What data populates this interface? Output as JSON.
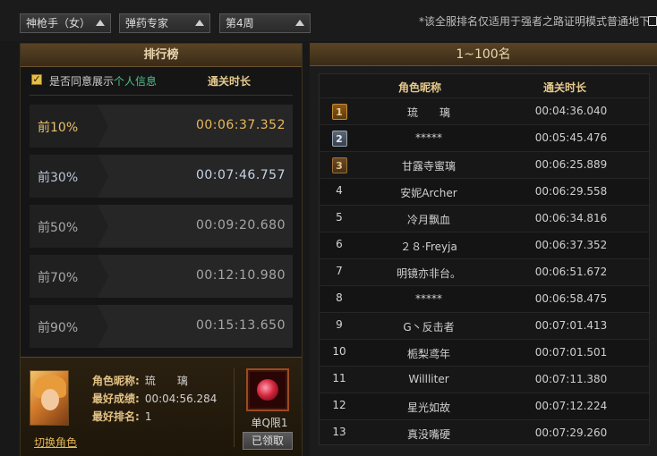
{
  "filters": {
    "class": "神枪手（女）",
    "job": "弹药专家",
    "week": "第4周",
    "notice": "*该全服排名仅适用于强者之路证明模式普通地下"
  },
  "left_panel": {
    "title": "排行榜",
    "agree_prefix": "是否同意展示",
    "agree_link": "个人信息",
    "clear_time_header": "通关时长",
    "percentiles": [
      {
        "label": "前10%",
        "time": "00:06:37.352"
      },
      {
        "label": "前30%",
        "time": "00:07:46.757"
      },
      {
        "label": "前50%",
        "time": "00:09:20.680"
      },
      {
        "label": "前70%",
        "time": "00:12:10.980"
      },
      {
        "label": "前90%",
        "time": "00:15:13.650"
      }
    ],
    "info": {
      "name_key": "角色昵称:",
      "name_val": "琉　　璃",
      "best_key": "最好成绩:",
      "best_val": "00:04:56.284",
      "rank_key": "最好排名:",
      "rank_val": "1",
      "switch_label": "切换角色",
      "reward_label": "单Q限1",
      "claim_label": "已领取"
    }
  },
  "right_panel": {
    "title": "1~100名",
    "headers": {
      "name": "角色昵称",
      "time": "通关时长"
    },
    "rows": [
      {
        "rank": "1",
        "name": "琉　　璃",
        "time": "00:04:36.040"
      },
      {
        "rank": "2",
        "name": "*****",
        "time": "00:05:45.476"
      },
      {
        "rank": "3",
        "name": "甘露寺蜜璃",
        "time": "00:06:25.889"
      },
      {
        "rank": "4",
        "name": "安妮Archer",
        "time": "00:06:29.558"
      },
      {
        "rank": "5",
        "name": "冷月飘血",
        "time": "00:06:34.816"
      },
      {
        "rank": "6",
        "name": "２８·Freyja",
        "time": "00:06:37.352"
      },
      {
        "rank": "7",
        "name": "明镜亦非台。",
        "time": "00:06:51.672"
      },
      {
        "rank": "8",
        "name": "*****",
        "time": "00:06:58.475"
      },
      {
        "rank": "9",
        "name": "G丶反击者",
        "time": "00:07:01.413"
      },
      {
        "rank": "10",
        "name": "栀梨鸢年",
        "time": "00:07:01.501"
      },
      {
        "rank": "11",
        "name": "Willliter",
        "time": "00:07:11.380"
      },
      {
        "rank": "12",
        "name": "星光如故",
        "time": "00:07:12.224"
      },
      {
        "rank": "13",
        "name": "真没嘴硬",
        "time": "00:07:29.260"
      }
    ]
  }
}
